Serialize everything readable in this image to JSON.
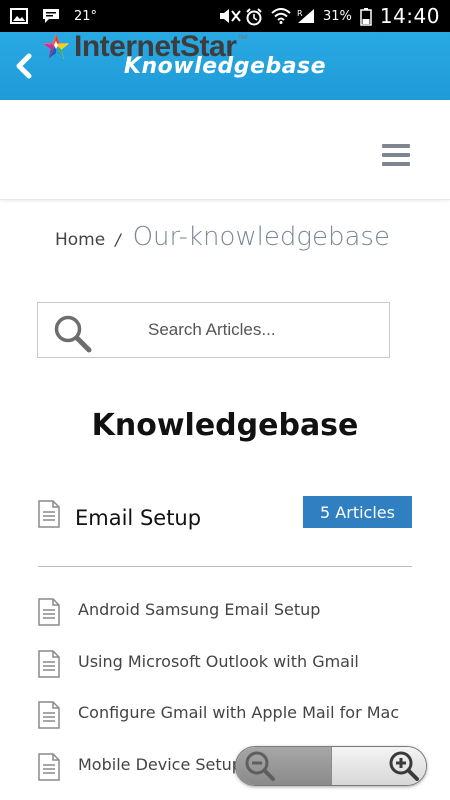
{
  "status_bar": {
    "temperature": "21°",
    "battery_percent": "31%",
    "time": "14:40",
    "icons": [
      "gallery-icon",
      "message-icon",
      "mute-icon",
      "alarm-icon",
      "wifi-icon",
      "signal-icon",
      "battery-icon"
    ]
  },
  "app_bar": {
    "title": "Knowledgebase",
    "back_icon": "chevron-left-icon",
    "color": "#23a3df"
  },
  "site_header": {
    "logo_text": "InternetStar",
    "logo_tm": "™",
    "menu_icon": "hamburger-icon"
  },
  "breadcrumb": {
    "home": "Home",
    "separator": "/",
    "current": "Our-knowledgebase"
  },
  "search": {
    "placeholder": "Search Articles...",
    "value": ""
  },
  "heading": "Knowledgebase",
  "category": {
    "title": "Email Setup",
    "count_label": "5 Articles",
    "badge_color": "#2f7fc1"
  },
  "articles": [
    {
      "title": "Android Samsung Email Setup"
    },
    {
      "title": "Using Microsoft Outlook with Gmail"
    },
    {
      "title": "Configure Gmail with Apple Mail for Mac"
    },
    {
      "title": "Mobile Device Setup"
    }
  ],
  "zoom_control": {
    "zoom_out_icon": "zoom-out-icon",
    "zoom_in_icon": "zoom-in-icon"
  }
}
